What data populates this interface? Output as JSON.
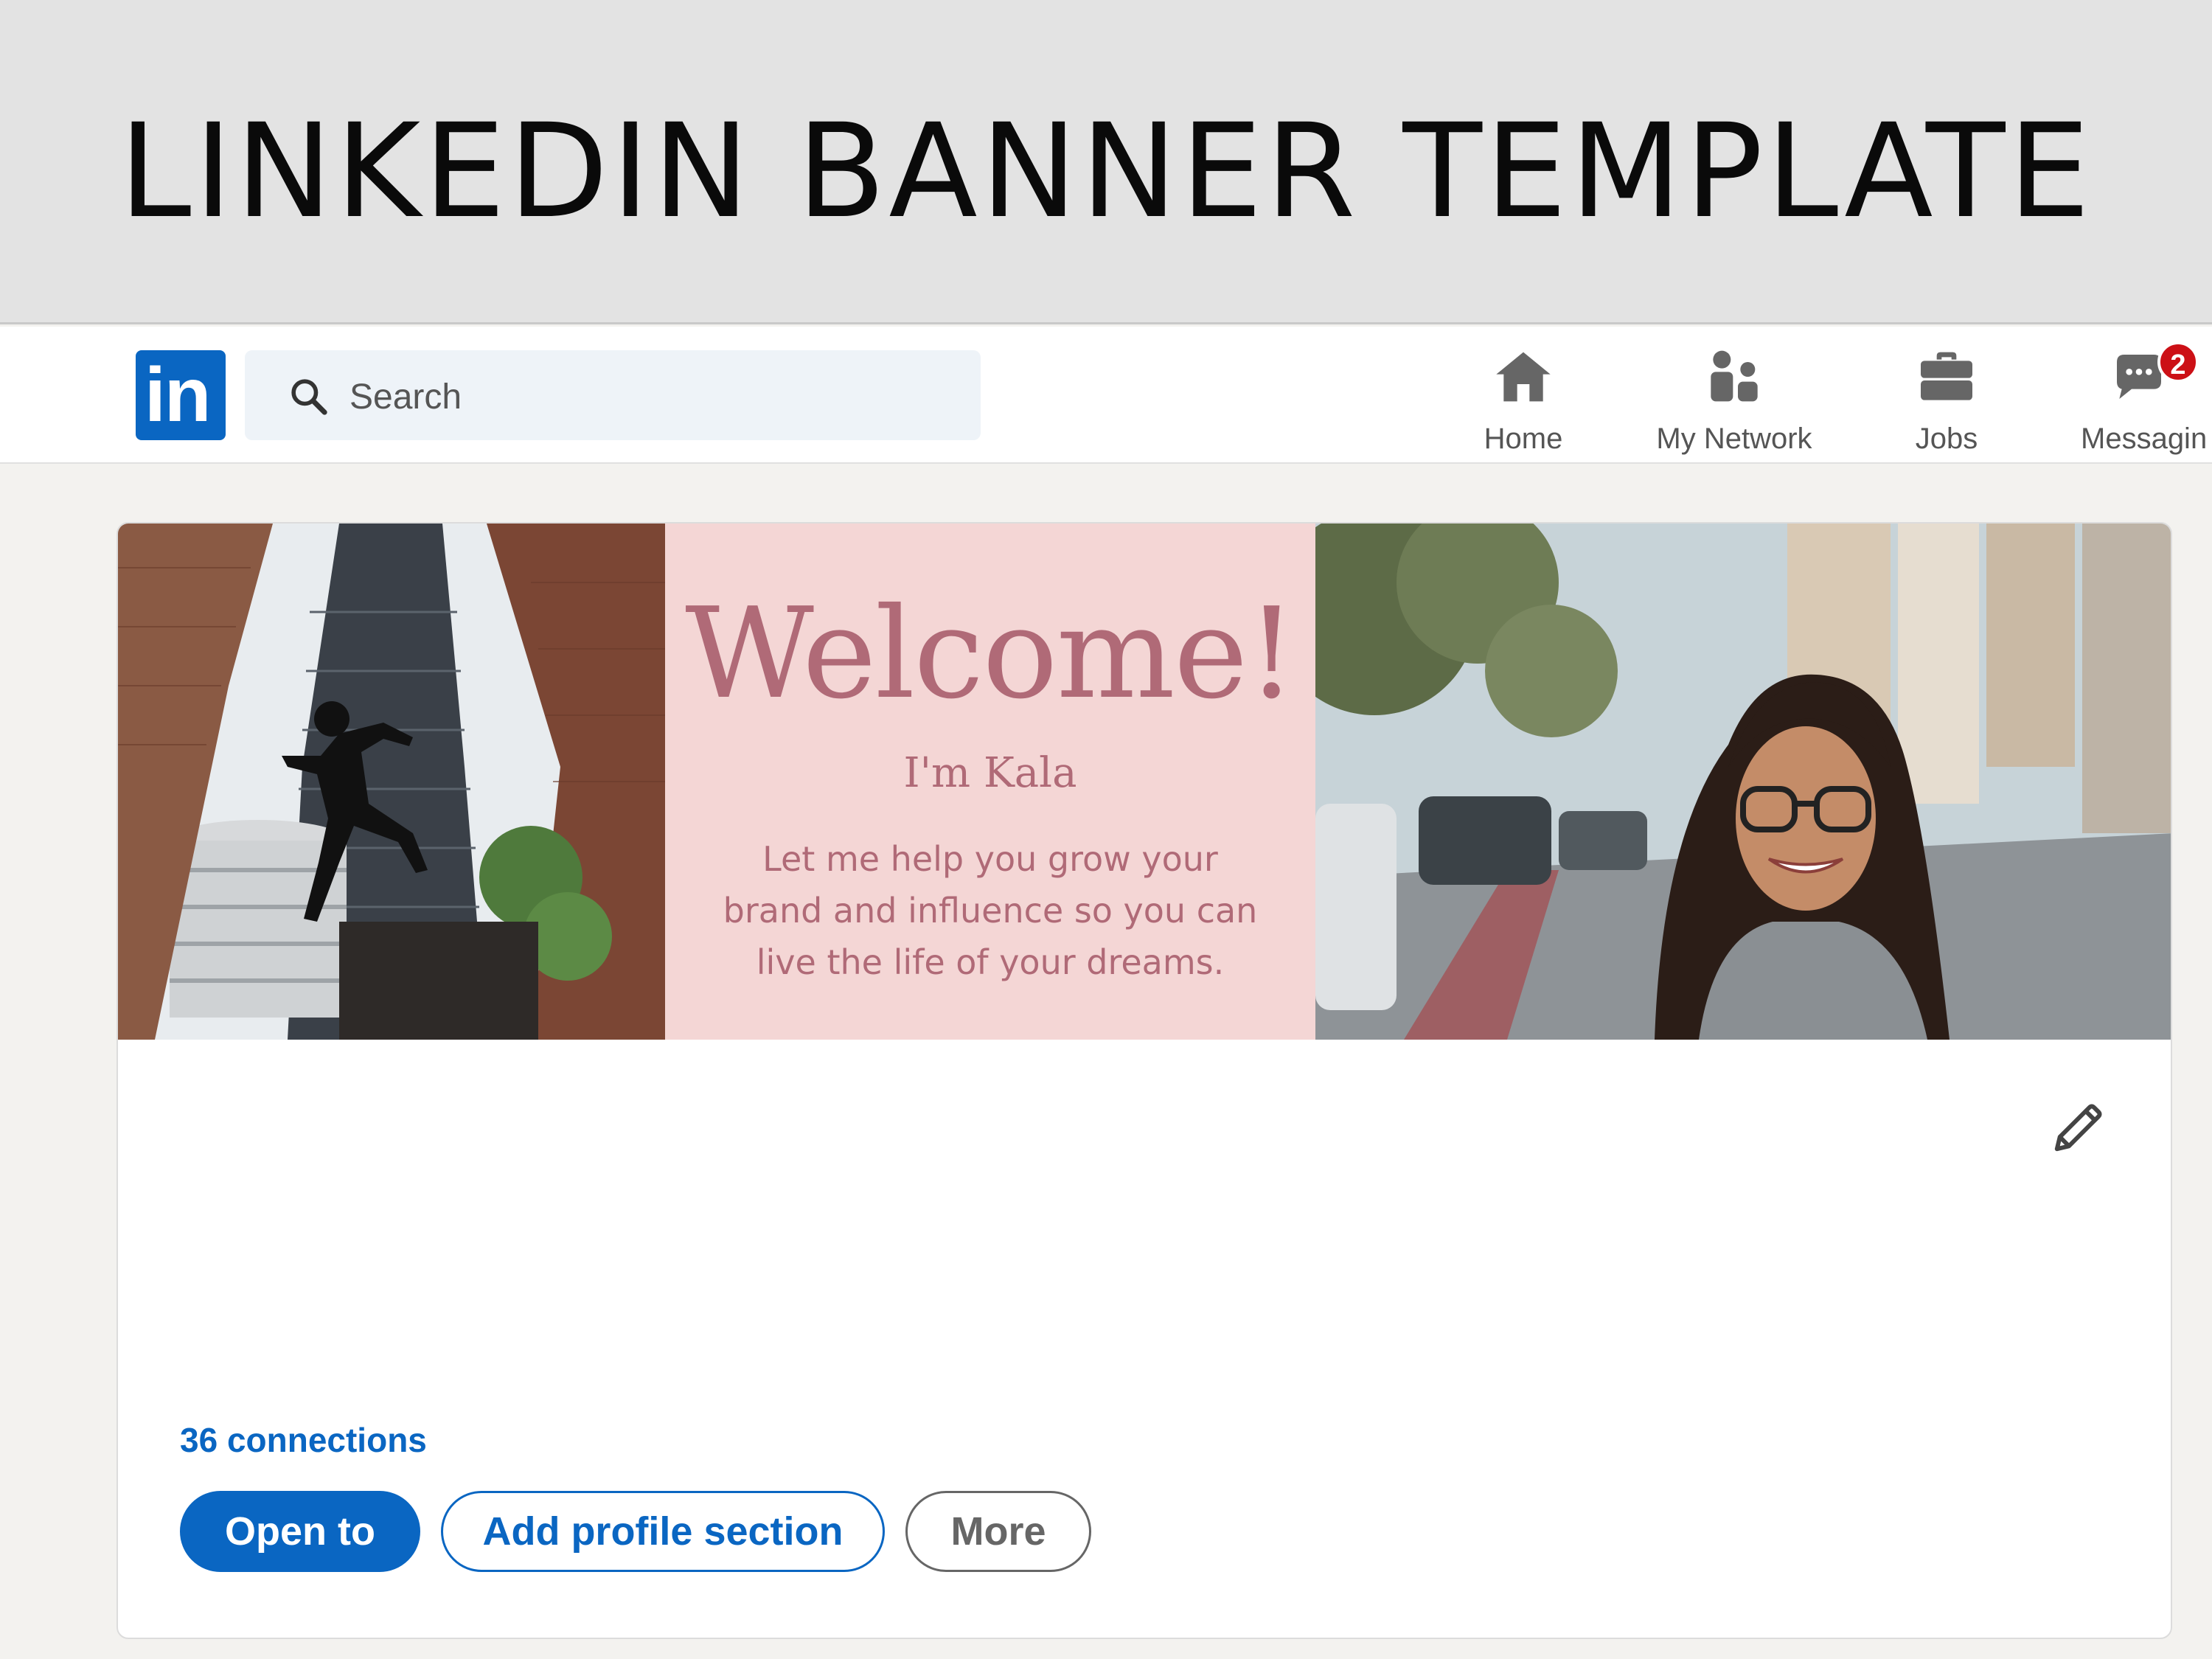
{
  "header": {
    "title": "LINKEDIN BANNER TEMPLATE"
  },
  "nav": {
    "logo_text": "in",
    "search_placeholder": "Search",
    "items": [
      {
        "label": "Home",
        "icon": "home-icon"
      },
      {
        "label": "My Network",
        "icon": "network-icon"
      },
      {
        "label": "Jobs",
        "icon": "briefcase-icon"
      },
      {
        "label": "Messagin",
        "icon": "messaging-icon",
        "badge": "2"
      }
    ]
  },
  "cover": {
    "heading": "Welcome!",
    "subheading": "I'm Kala",
    "tagline": "Let me help you grow your brand and influence so you can live the life of your dreams."
  },
  "profile": {
    "connections": "36 connections",
    "buttons": {
      "open_to": "Open to",
      "add_section": "Add profile section",
      "more": "More"
    }
  },
  "colors": {
    "linkedin_blue": "#0a66c2",
    "cover_pink": "#f4d6d5",
    "cover_text": "#b06a77",
    "badge_red": "#cc1016"
  }
}
